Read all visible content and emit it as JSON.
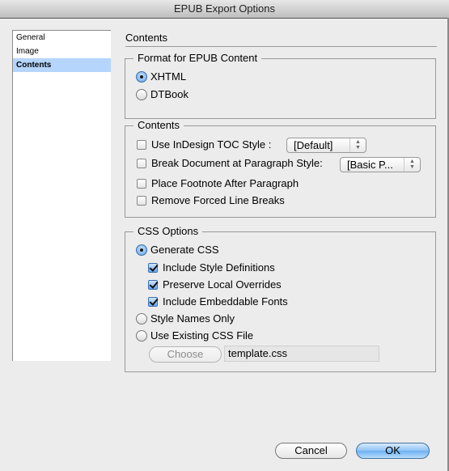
{
  "window": {
    "title": "EPUB Export Options"
  },
  "sidebar": {
    "items": [
      {
        "label": "General",
        "selected": false
      },
      {
        "label": "Image",
        "selected": false
      },
      {
        "label": "Contents",
        "selected": true
      }
    ]
  },
  "panel": {
    "title": "Contents",
    "format_group": {
      "legend": "Format for EPUB Content",
      "options": [
        {
          "label": "XHTML",
          "selected": true
        },
        {
          "label": "DTBook",
          "selected": false
        }
      ]
    },
    "contents_group": {
      "legend": "Contents",
      "toc_style": {
        "label": "Use InDesign TOC Style :",
        "checked": false,
        "popup_value": "[Default]"
      },
      "break_doc": {
        "label": "Break Document at Paragraph Style:",
        "checked": false,
        "popup_value": "[Basic P..."
      },
      "footnote": {
        "label": "Place Footnote After Paragraph",
        "checked": false
      },
      "line_breaks": {
        "label": "Remove Forced Line Breaks",
        "checked": false
      }
    },
    "css_group": {
      "legend": "CSS Options",
      "generate_css": {
        "label": "Generate CSS",
        "selected": true
      },
      "include_style_defs": {
        "label": "Include Style Definitions",
        "checked": true
      },
      "preserve_overrides": {
        "label": "Preserve Local Overrides",
        "checked": true
      },
      "embed_fonts": {
        "label": "Include Embeddable Fonts",
        "checked": true
      },
      "style_names_only": {
        "label": "Style Names Only",
        "selected": false
      },
      "existing_css": {
        "label": "Use Existing CSS File",
        "selected": false
      },
      "choose_button": "Choose",
      "css_file": "template.css"
    }
  },
  "footer": {
    "cancel": "Cancel",
    "ok": "OK"
  },
  "icons": {
    "popup_arrows": "▲▼"
  }
}
